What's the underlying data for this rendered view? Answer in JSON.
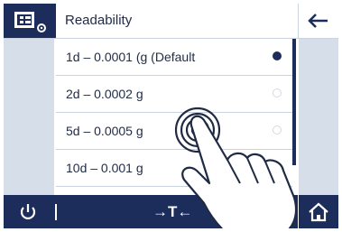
{
  "header": {
    "title": "Readability"
  },
  "icons": {
    "settings": "settings-list-icon",
    "back": "arrow-left-icon",
    "power": "power-icon",
    "home": "home-icon",
    "touch": "touch-gesture-icon"
  },
  "options": [
    {
      "label": "1d – 0.0001 (g (Default",
      "selected": true
    },
    {
      "label": "2d – 0.0002 g",
      "selected": false
    },
    {
      "label": "5d – 0.0005 g",
      "selected": false
    },
    {
      "label": "10d – 0.001 g",
      "selected": false
    }
  ],
  "footer": {
    "tare_label": "→T←"
  },
  "colors": {
    "primary": "#1c2d5c",
    "side_panel": "#d6dee9",
    "divider": "#c9d3e0"
  }
}
